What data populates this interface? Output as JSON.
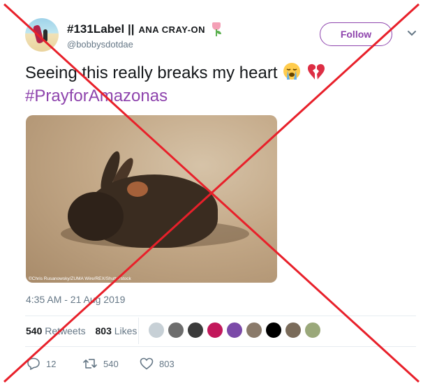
{
  "user": {
    "display_name": "#131Label ||",
    "name_suffix": "ANA CRAY-ON",
    "handle": "@bobbysdotdae",
    "follow_label": "Follow"
  },
  "tweet": {
    "text": "Seeing this really breaks my heart",
    "hashtag": "#PrayforAmazonas",
    "photo_credit": "©Chris Rusanowsky/ZUMA Wire/REX/Shutterstock",
    "timestamp": "4:35 AM - 21 Aug 2019"
  },
  "stats": {
    "retweets_count": "540",
    "retweets_label": "Retweets",
    "likes_count": "803",
    "likes_label": "Likes"
  },
  "actions": {
    "reply_count": "12",
    "retweet_count": "540",
    "like_count": "803"
  },
  "icons": [
    "crying-face-icon",
    "broken-heart-icon",
    "tulip-icon",
    "chevron-down-icon",
    "reply-icon",
    "retweet-icon",
    "heart-icon"
  ],
  "colors": {
    "accent": "#8e44ad",
    "muted_text": "#657786",
    "overlay_cross": "#e8202a"
  }
}
